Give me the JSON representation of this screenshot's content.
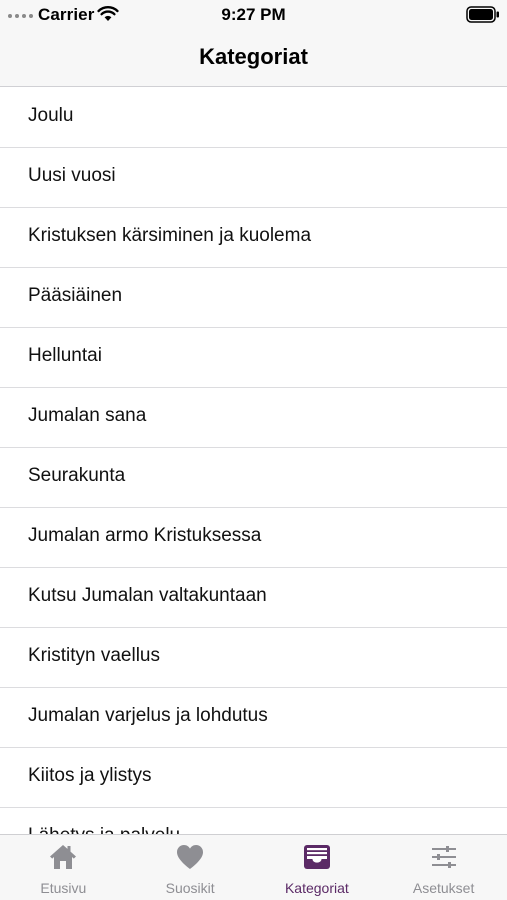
{
  "status_bar": {
    "carrier": "Carrier",
    "time": "9:27 PM"
  },
  "nav": {
    "title": "Kategoriat"
  },
  "categories": [
    "Joulu",
    "Uusi vuosi",
    "Kristuksen kärsiminen ja kuolema",
    "Pääsiäinen",
    "Helluntai",
    "Jumalan sana",
    "Seurakunta",
    "Jumalan armo Kristuksessa",
    "Kutsu Jumalan valtakuntaan",
    "Kristityn vaellus",
    "Jumalan varjelus ja lohdutus",
    "Kiitos ja ylistys",
    "Lähetys ja palvelu"
  ],
  "tabs": [
    {
      "label": "Etusivu",
      "icon": "home-icon",
      "active": false
    },
    {
      "label": "Suosikit",
      "icon": "heart-icon",
      "active": false
    },
    {
      "label": "Kategoriat",
      "icon": "tray-icon",
      "active": true
    },
    {
      "label": "Asetukset",
      "icon": "sliders-icon",
      "active": false
    }
  ],
  "colors": {
    "accent": "#5b2a66",
    "inactive": "#8e8e93"
  }
}
